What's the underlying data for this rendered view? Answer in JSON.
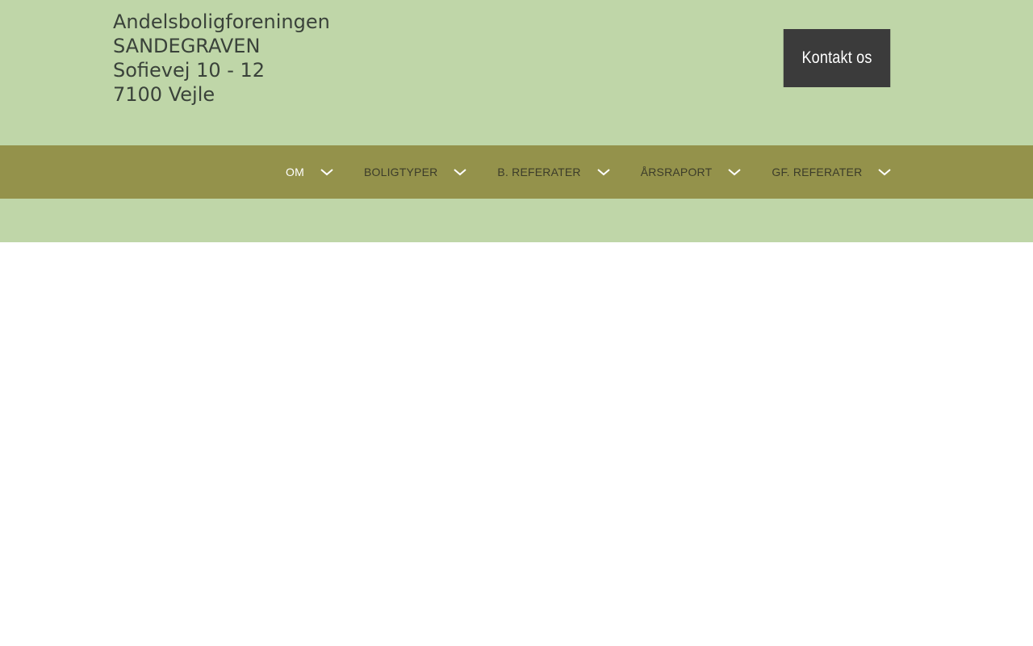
{
  "header": {
    "brand_lines": [
      "Andelsboligforeningen",
      "SANDEGRAVEN",
      "Sofievej 10 - 12",
      "7100 Vejle"
    ],
    "contact_label": "Kontakt os"
  },
  "nav": {
    "items": [
      {
        "label": "OM",
        "active": true
      },
      {
        "label": "BOLIGTYPER",
        "active": false
      },
      {
        "label": "B. REFERATER",
        "active": false
      },
      {
        "label": "ÅRSRAPORT",
        "active": false
      },
      {
        "label": "GF. REFERATER",
        "active": false
      }
    ],
    "icon": "chevron-down-icon"
  },
  "colors": {
    "header_bg": "#bfd6a8",
    "nav_bg": "#94924b",
    "button_bg": "#3b3b3b",
    "text_dark": "#3a423a",
    "active_nav_text": "#ffffff"
  }
}
